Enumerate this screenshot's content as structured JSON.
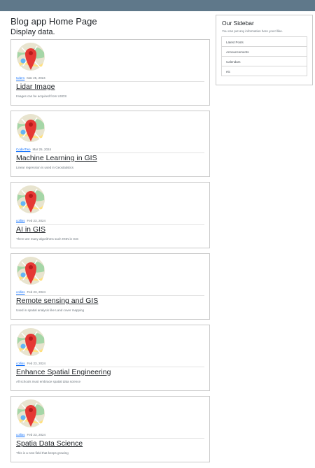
{
  "header": {
    "title": "Blog app Home Page",
    "subtitle": "Display data."
  },
  "posts": [
    {
      "author": "Uder1",
      "date": "Mar 25, 2024",
      "title": "Lidar Image",
      "excerpt": "Images can be acquired from USGS"
    },
    {
      "author": "CoderTwo",
      "date": "Mar 25, 2024",
      "title": "Machine Learning in GIS",
      "excerpt": "Linear regression is used in Geostatistics"
    },
    {
      "author": "collins",
      "date": "Feb 23, 2024",
      "title": "AI in GIS",
      "excerpt": "There are many algorithms such KNN in GIS"
    },
    {
      "author": "collins",
      "date": "Feb 23, 2024",
      "title": "Remote sensing and GIS",
      "excerpt": "Used in spatial analysis like Land cover mapping"
    },
    {
      "author": "collins",
      "date": "Feb 23, 2024",
      "title": "Enhance Spatial Engineering",
      "excerpt": "All schools must embrace spatial data science"
    },
    {
      "author": "collins",
      "date": "Feb 23, 2024",
      "title": "Spatia Data Science",
      "excerpt": "This is a new field that keeps growing"
    }
  ],
  "sidebar": {
    "title": "Our Sidebar",
    "description": "You can put any information here you'd like.",
    "items": [
      "Latest Posts",
      "Announcements",
      "Calendars",
      "etc"
    ]
  },
  "colors": {
    "topbar": "#5f788a",
    "link": "#0d6efd",
    "map_pin": "#e53935"
  },
  "icons": {
    "post_thumbnail": "map-pin-icon"
  }
}
